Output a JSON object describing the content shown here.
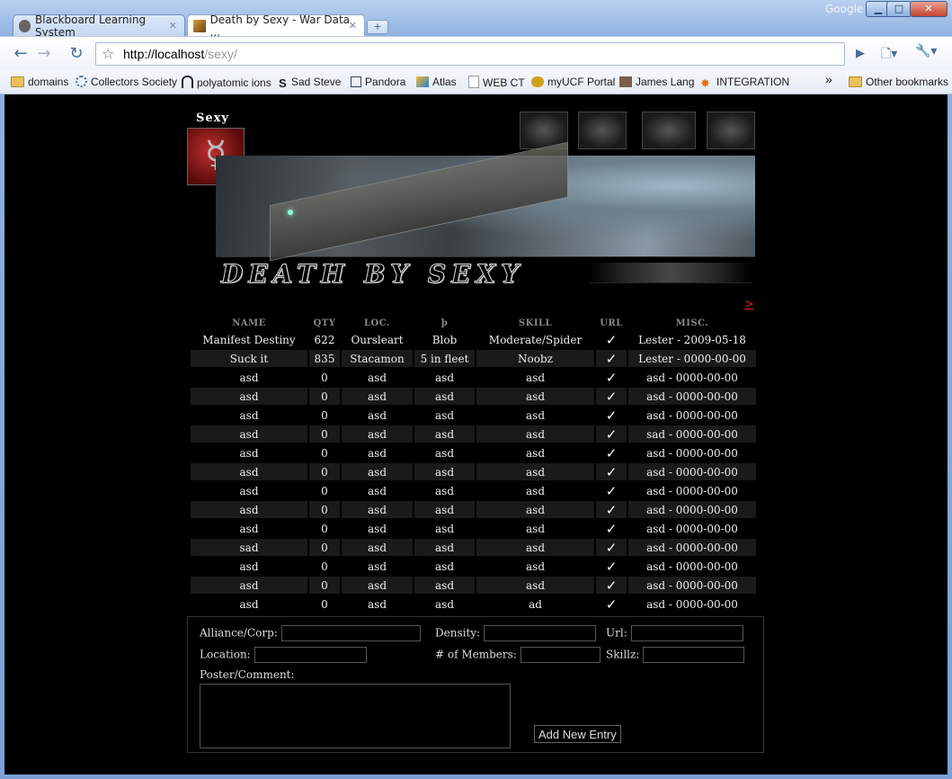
{
  "browser": {
    "tabs": [
      {
        "title": "Blackboard Learning System",
        "active": false
      },
      {
        "title": "Death by Sexy - War Data ...",
        "active": true
      }
    ],
    "google_label": "Google",
    "window_buttons": {
      "minimize": "▁",
      "maximize": "□",
      "close": "✕"
    },
    "url_host": "http://localhost",
    "url_path": "/sexy/",
    "bookmarks": [
      "domains",
      "Collectors Society",
      "polyatomic ions",
      "Sad Steve",
      "Pandora",
      "Atlas",
      "WEB CT",
      "myUCF Portal",
      "James Lang",
      "INTEGRATION"
    ],
    "overflow_label": "»",
    "other_bookmarks": "Other bookmarks"
  },
  "page": {
    "logo_word": "Sexy",
    "logo_symbol": "☿",
    "title_art": "DEATH BY SEXY",
    "next_link": ">",
    "columns": [
      "NAME",
      "QTY",
      "LOC.",
      "þ",
      "SKILL",
      "URL",
      "MISC."
    ],
    "check_glyph": "✓",
    "rows": [
      {
        "name": "Manifest Destiny",
        "qty": "622",
        "loc": "Oursleart",
        "density": "Blob",
        "skill": "Moderate/Spider",
        "misc": "Lester - 2009-05-18"
      },
      {
        "name": "Suck it",
        "qty": "835",
        "loc": "Stacamon",
        "density": "5 in fleet",
        "skill": "Noobz",
        "misc": "Lester - 0000-00-00"
      },
      {
        "name": "asd",
        "qty": "0",
        "loc": "asd",
        "density": "asd",
        "skill": "asd",
        "misc": "asd - 0000-00-00"
      },
      {
        "name": "asd",
        "qty": "0",
        "loc": "asd",
        "density": "asd",
        "skill": "asd",
        "misc": "asd - 0000-00-00"
      },
      {
        "name": "asd",
        "qty": "0",
        "loc": "asd",
        "density": "asd",
        "skill": "asd",
        "misc": "asd - 0000-00-00"
      },
      {
        "name": "asd",
        "qty": "0",
        "loc": "asd",
        "density": "asd",
        "skill": "asd",
        "misc": "sad - 0000-00-00"
      },
      {
        "name": "asd",
        "qty": "0",
        "loc": "asd",
        "density": "asd",
        "skill": "asd",
        "misc": "asd - 0000-00-00"
      },
      {
        "name": "asd",
        "qty": "0",
        "loc": "asd",
        "density": "asd",
        "skill": "asd",
        "misc": "asd - 0000-00-00"
      },
      {
        "name": "asd",
        "qty": "0",
        "loc": "asd",
        "density": "asd",
        "skill": "asd",
        "misc": "asd - 0000-00-00"
      },
      {
        "name": "asd",
        "qty": "0",
        "loc": "asd",
        "density": "asd",
        "skill": "asd",
        "misc": "asd - 0000-00-00"
      },
      {
        "name": "asd",
        "qty": "0",
        "loc": "asd",
        "density": "asd",
        "skill": "asd",
        "misc": "asd - 0000-00-00"
      },
      {
        "name": "sad",
        "qty": "0",
        "loc": "asd",
        "density": "asd",
        "skill": "asd",
        "misc": "asd - 0000-00-00"
      },
      {
        "name": "asd",
        "qty": "0",
        "loc": "asd",
        "density": "asd",
        "skill": "asd",
        "misc": "asd - 0000-00-00"
      },
      {
        "name": "asd",
        "qty": "0",
        "loc": "asd",
        "density": "asd",
        "skill": "asd",
        "misc": "asd - 0000-00-00"
      },
      {
        "name": "asd",
        "qty": "0",
        "loc": "asd",
        "density": "asd",
        "skill": "ad",
        "misc": "asd - 0000-00-00"
      }
    ],
    "form": {
      "alliance_label": "Alliance/Corp:",
      "density_label": "Density:",
      "url_label": "Url:",
      "location_label": "Location:",
      "members_label": "# of Members:",
      "skillz_label": "Skillz:",
      "comment_label": "Poster/Comment:",
      "submit_label": "Add New Entry"
    }
  }
}
